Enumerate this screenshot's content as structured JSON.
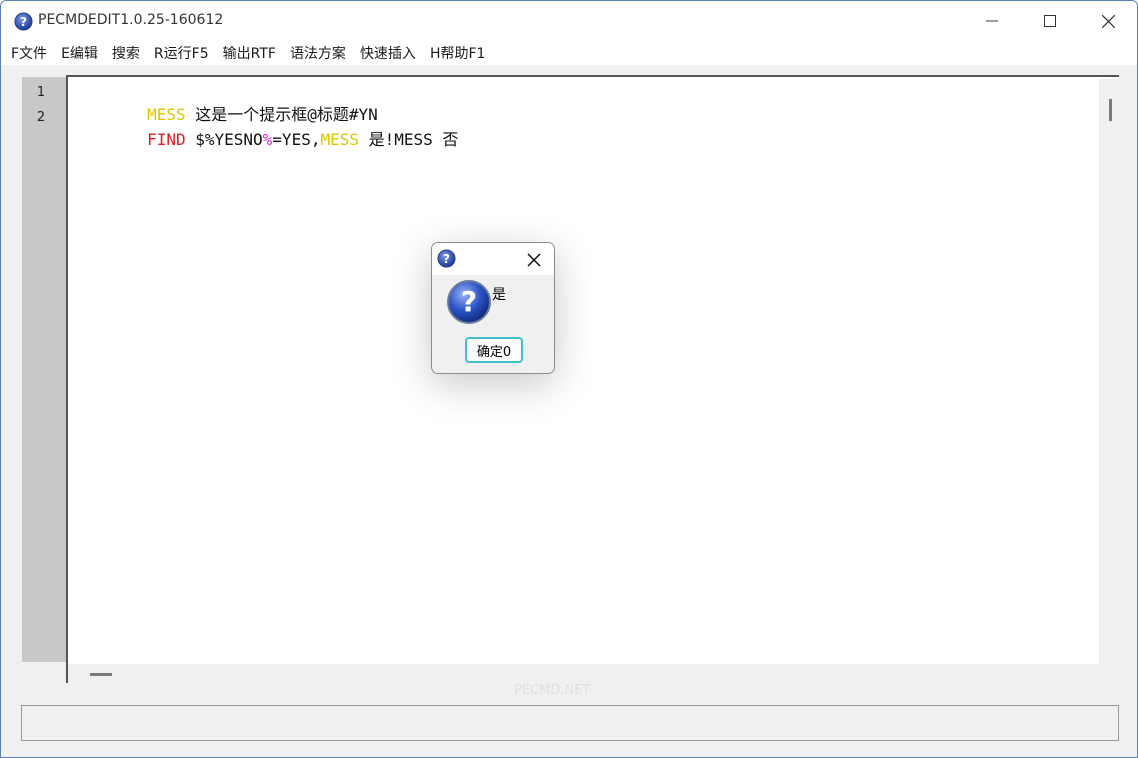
{
  "window": {
    "title": "PECMDEDIT1.0.25-160612"
  },
  "menu": {
    "items": [
      "F文件",
      "E编辑",
      "搜索",
      "R运行F5",
      "输出RTF",
      "语法方案",
      "快速插入",
      "H帮助F1"
    ]
  },
  "editor": {
    "line_numbers": [
      "1",
      "2"
    ],
    "lines": [
      {
        "tokens": [
          {
            "text": "MESS",
            "color": "#d9c700"
          },
          {
            "text": " 这是一个提示框@标题#YN",
            "color": "#111111"
          }
        ]
      },
      {
        "tokens": [
          {
            "text": "FIND",
            "color": "#e02020"
          },
          {
            "text": " $%YESNO",
            "color": "#111111"
          },
          {
            "text": "%",
            "color": "#e020d0"
          },
          {
            "text": "=YES,",
            "color": "#111111"
          },
          {
            "text": "MESS",
            "color": "#d9c700"
          },
          {
            "text": " 是!MESS 否",
            "color": "#111111"
          }
        ]
      }
    ]
  },
  "watermark": "PECMD.NET",
  "dialog": {
    "message": "是",
    "ok_label": "确定0",
    "icon": "question-icon"
  },
  "icons": {
    "app": "question-icon",
    "minimize": "minimize-icon",
    "maximize": "maximize-icon",
    "close": "close-icon"
  }
}
